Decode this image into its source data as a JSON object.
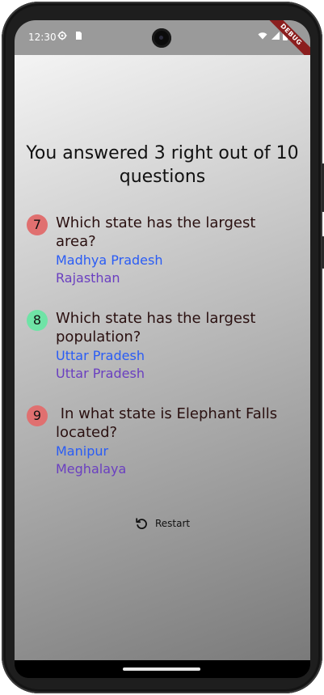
{
  "status": {
    "time": "12:30",
    "debug_label": "DEBUG",
    "icons": [
      "settings-icon",
      "sim-card-icon",
      "wifi-icon",
      "signal-icon",
      "battery-icon"
    ]
  },
  "result": {
    "title": "You answered 3 right out of 10 questions"
  },
  "summary": [
    {
      "number": "7",
      "question": "Which state has the largest area?",
      "correct_answer": "Madhya Pradesh",
      "user_answer": "Rajasthan",
      "badge_color": "#e07070"
    },
    {
      "number": "8",
      "question": "Which state has the largest population?",
      "correct_answer": "Uttar Pradesh",
      "user_answer": "Uttar Pradesh",
      "badge_color": "#6fe3a6"
    },
    {
      "number": "9",
      "question": " In what state is Elephant Falls located?",
      "correct_answer": "Manipur",
      "user_answer": "Meghalaya",
      "badge_color": "#e07070"
    }
  ],
  "actions": {
    "restart_label": "Restart",
    "restart_icon": "restart-icon"
  },
  "colors": {
    "correct_answer": "#2a5cf5",
    "user_answer": "#6a3fc0",
    "question": "#2a1010"
  }
}
